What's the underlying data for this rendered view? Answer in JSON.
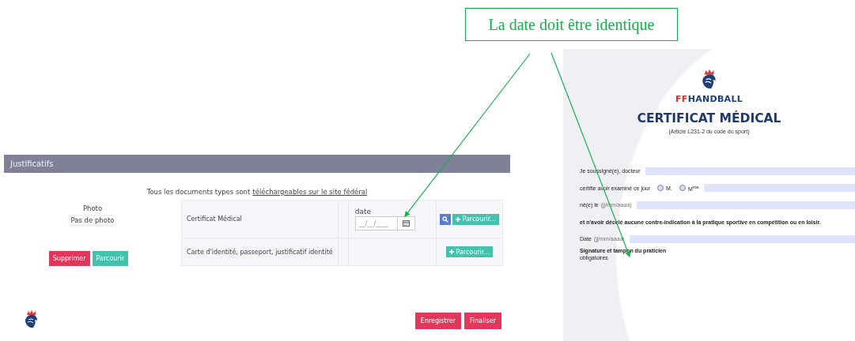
{
  "callout": {
    "text": "La date doit être identique"
  },
  "form": {
    "header": "Justificatifs",
    "notice": {
      "text": "Tous les documents types sont",
      "link": "téléchargeables sur le site fédéral"
    },
    "photo": {
      "label": "Photo",
      "value": "Pas de photo",
      "buttons": [
        {
          "kind": "danger",
          "label": "Supprimer"
        },
        {
          "kind": "primary",
          "label": "Parcourir"
        }
      ]
    },
    "documents": [
      {
        "name": "Certificat Médical",
        "date_label": "date",
        "date_placeholder": "__/__/____",
        "has_view": true,
        "browse": "Parcourir..."
      },
      {
        "name": "Carte d'identité, passeport, justificatif identité",
        "has_view": false,
        "browse": "Parcourir..."
      }
    ],
    "footer_buttons": [
      "Enregistrer",
      "Finaliser"
    ]
  },
  "certificate": {
    "brand": {
      "accent": "FF",
      "rest": "HANDBALL"
    },
    "title": "CERTIFICAT MÉDICAL",
    "subtitle": "(Article L231-2 du code du sport)",
    "fields": [
      {
        "kind": "text",
        "label": "Je soussigné(e), docteur"
      },
      {
        "kind": "radio",
        "label": "certifie avoir examiné ce jour",
        "options": [
          {
            "label": "M.",
            "selected": false
          },
          {
            "label": "M$^{me}$",
            "selected": false
          }
        ]
      },
      {
        "kind": "text",
        "label": "né(e) le",
        "hint": "(jj/mm/aaaa)"
      },
      {
        "kind": "statement",
        "label": "et n'avoir décelé aucune contre-indication à la pratique sportive en compétition ou en loisir."
      },
      {
        "kind": "text",
        "label": "Date",
        "hint": "(jj/mm/aaaa)"
      }
    ],
    "signature": {
      "title": "Signature et tampon du praticien",
      "note": "obligatoires"
    }
  }
}
